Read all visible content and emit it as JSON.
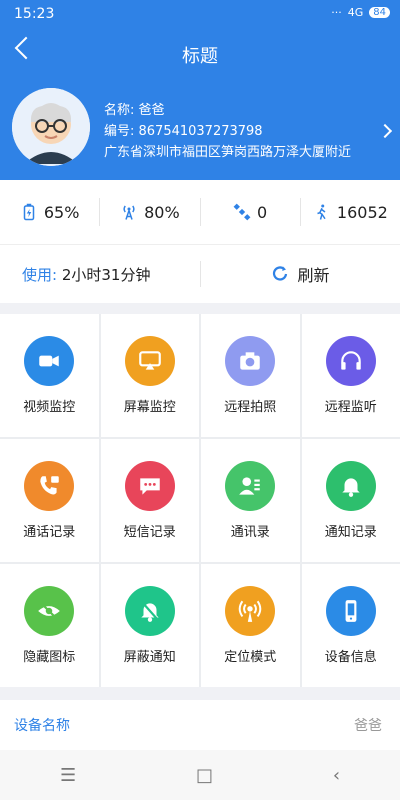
{
  "status": {
    "time": "15:23",
    "signal": "4G",
    "battery": "84"
  },
  "header": {
    "title": "标题"
  },
  "profile": {
    "name_label": "名称: 爸爸",
    "id_label": "编号: 867541037273798",
    "address": "广东省深圳市福田区笋岗西路万泽大厦附近"
  },
  "stats": {
    "battery": "65%",
    "signal": "80%",
    "satellite": "0",
    "steps": "16052"
  },
  "usage": {
    "label": "使用:",
    "value": "2小时31分钟",
    "refresh": "刷新"
  },
  "grid": [
    {
      "label": "视频监控",
      "icon": "video-camera-icon",
      "color": "#2b8be6"
    },
    {
      "label": "屏幕监控",
      "icon": "screen-cast-icon",
      "color": "#f0a020"
    },
    {
      "label": "远程拍照",
      "icon": "camera-icon",
      "color": "#8f9bf0"
    },
    {
      "label": "远程监听",
      "icon": "headphones-icon",
      "color": "#6b5ce7"
    },
    {
      "label": "通话记录",
      "icon": "phone-icon",
      "color": "#f08a2c"
    },
    {
      "label": "短信记录",
      "icon": "message-icon",
      "color": "#e8455a"
    },
    {
      "label": "通讯录",
      "icon": "contacts-icon",
      "color": "#45c46a"
    },
    {
      "label": "通知记录",
      "icon": "bell-icon",
      "color": "#2dbf6d"
    },
    {
      "label": "隐藏图标",
      "icon": "eye-hidden-icon",
      "color": "#58c24a"
    },
    {
      "label": "屏蔽通知",
      "icon": "bell-off-icon",
      "color": "#1fc58a"
    },
    {
      "label": "定位模式",
      "icon": "location-signal-icon",
      "color": "#f0a020"
    },
    {
      "label": "设备信息",
      "icon": "phone-device-icon",
      "color": "#2b8be6"
    }
  ],
  "device": {
    "label": "设备名称",
    "value": "爸爸"
  }
}
